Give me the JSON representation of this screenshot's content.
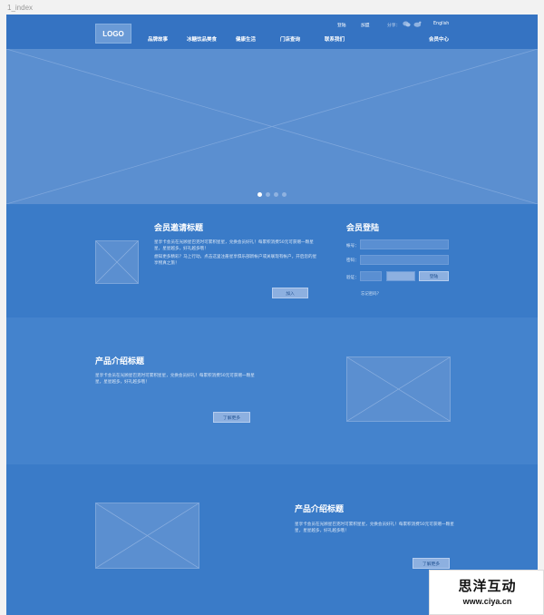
{
  "page_label": "1_index",
  "header": {
    "logo": "LOGO",
    "nav": [
      "品牌故事",
      "冰糖饮品美食",
      "健康生活",
      "门店查询",
      "联系我们"
    ],
    "member_center": "会员中心",
    "top_links": {
      "login": "登陆",
      "join": "加盟",
      "share": "分享：",
      "english": "English"
    }
  },
  "banner": {
    "dots": 4,
    "active_dot": 1
  },
  "member_invite": {
    "title": "会员邀请标题",
    "text1": "星享卡会员在光顾星巴克时可累积星星，兑换会员好礼！每累积消费50元可获赠一颗星星，星星越多，好礼越多哦！",
    "text2": "想知更多精彩？马上行动，点击这里注册星享俱乐部新帐户或关联现有帐户，开启您的星享物真之旅！",
    "button": "加入"
  },
  "member_login": {
    "title": "会员登陆",
    "account_label": "帐号：",
    "password_label": "密码：",
    "captcha_label": "验证：",
    "login_button": "登陆",
    "forgot": "忘记密码？"
  },
  "product_1": {
    "title": "产品介绍标题",
    "text": "星享卡会员在光顾星巴克时可累积星星，兑换会员好礼！每累积消费50元可获赠一颗星星，星星越多，好礼越多哦！",
    "button": "了解更多"
  },
  "product_2": {
    "title": "产品介绍标题",
    "text": "星享卡会员在光顾星巴克时可累积星星，兑换会员好礼！每累积消费50元可获赠一颗星星，星星越多，好礼越多哦！",
    "button": "了解更多"
  },
  "watermark": {
    "name": "思洋互动",
    "url": "www.ciya.cn"
  },
  "colors": {
    "brand_blue": "#3a7bc8",
    "banner": "#5b8fd0",
    "button": "#8db0e0"
  }
}
